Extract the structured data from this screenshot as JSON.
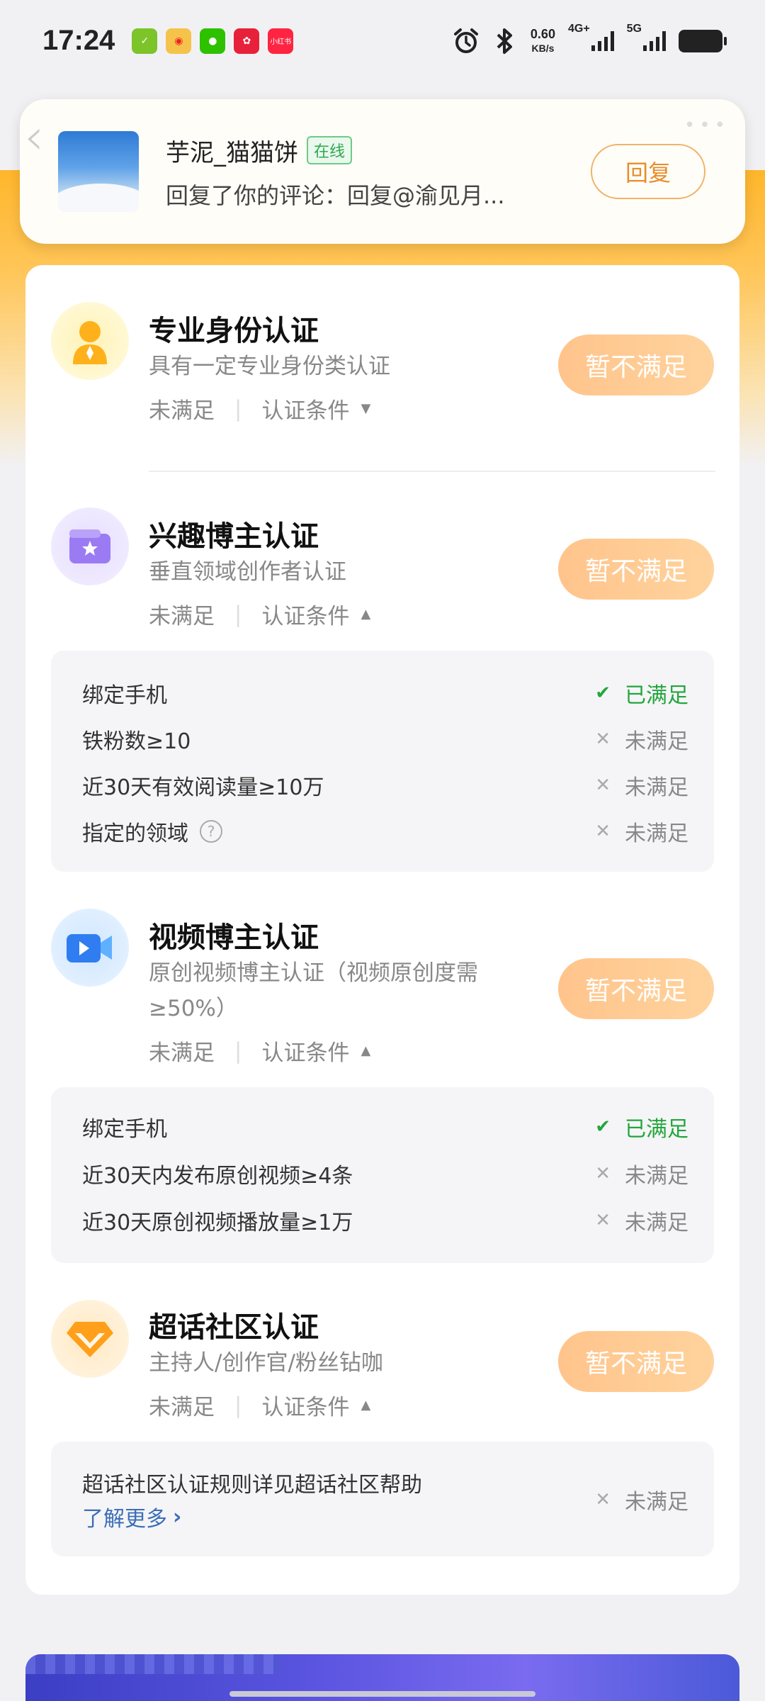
{
  "status_bar": {
    "time": "17:24",
    "net_speed_value": "0.60",
    "net_speed_unit": "KB/s",
    "sim1_label": "4G+",
    "sim2_label": "5G",
    "app_icons": [
      "phone-check-icon",
      "weibo-icon",
      "wechat-icon",
      "taobao-icon",
      "xiaohongshu-icon"
    ],
    "xiaohongshu_label": "小红书"
  },
  "notification": {
    "name": "芋泥_猫猫饼",
    "online_tag": "在线",
    "message": "回复了你的评论：回复@渝见月...",
    "reply_label": "回复"
  },
  "certifications": [
    {
      "title": "专业身份认证",
      "subtitle": "具有一定专业身份类认证",
      "status": "未满足",
      "conditions_label": "认证条件",
      "button_label": "暂不满足",
      "icon": "person-tie-icon"
    },
    {
      "title": "兴趣博主认证",
      "subtitle": "垂直领域创作者认证",
      "status": "未满足",
      "conditions_label": "认证条件",
      "button_label": "暂不满足",
      "icon": "star-wallet-icon",
      "conditions": [
        {
          "label": "绑定手机",
          "status": "已满足"
        },
        {
          "label": "铁粉数≥10",
          "status": "未满足"
        },
        {
          "label": "近30天有效阅读量≥10万",
          "status": "未满足"
        },
        {
          "label": "指定的领域",
          "status": "未满足"
        }
      ]
    },
    {
      "title": "视频博主认证",
      "subtitle_line1": "原创视频博主认证（视频原创度需",
      "subtitle_line2": "≥50%）",
      "status": "未满足",
      "conditions_label": "认证条件",
      "button_label": "暂不满足",
      "icon": "video-camera-icon",
      "conditions": [
        {
          "label": "绑定手机",
          "status": "已满足"
        },
        {
          "label": "近30天内发布原创视频≥4条",
          "status": "未满足"
        },
        {
          "label": "近30天原创视频播放量≥1万",
          "status": "未满足"
        }
      ]
    },
    {
      "title": "超话社区认证",
      "subtitle": "主持人/创作官/粉丝钻咖",
      "status": "未满足",
      "conditions_label": "认证条件",
      "button_label": "暂不满足",
      "icon": "diamond-icon",
      "conditions": [
        {
          "label": "超话社区认证规则详见超话社区帮助",
          "link": "了解更多",
          "status": "未满足"
        }
      ]
    }
  ],
  "colors": {
    "accent_orange": "#ffc48c",
    "ok_green": "#23a63c",
    "link_blue": "#3b6fb6"
  }
}
